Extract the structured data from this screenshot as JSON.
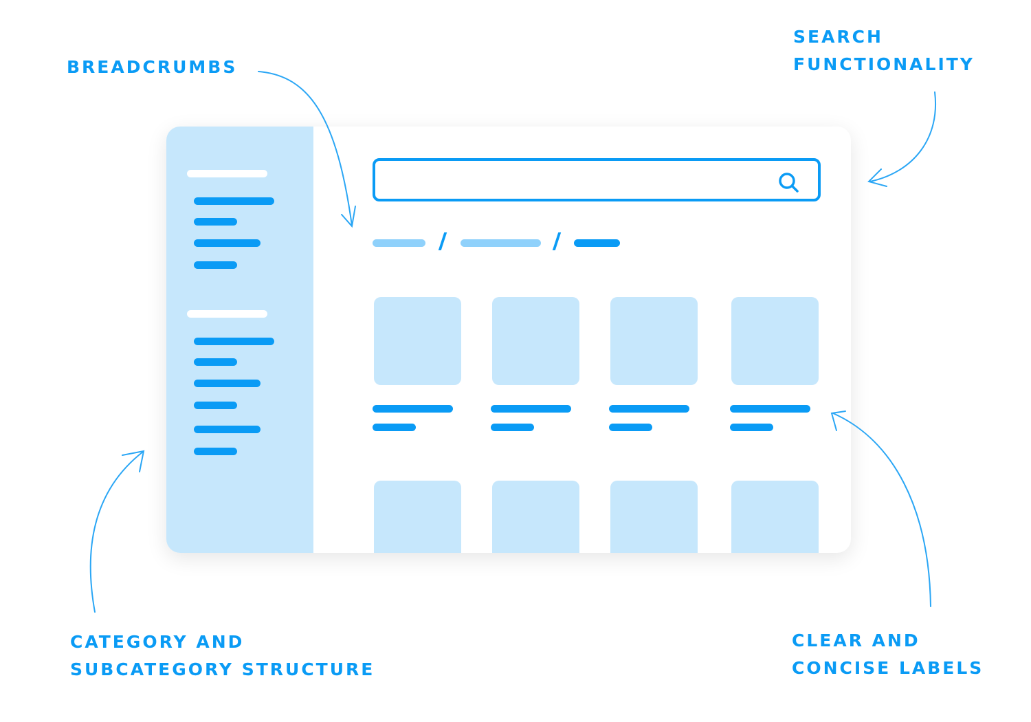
{
  "annotations": {
    "breadcrumbs": "BREADCRUMBS",
    "search_line1": "SEARCH",
    "search_line2": "FUNCTIONALITY",
    "category_line1": "CATEGORY AND",
    "category_line2": "SUBCATEGORY STRUCTURE",
    "labels_line1": "CLEAR AND",
    "labels_line2": "CONCISE LABELS"
  },
  "colors": {
    "accent": "#0a9bf5",
    "light_fill": "#c6e7fc",
    "breadcrumb_inactive": "#8fd1fb"
  },
  "search": {
    "value": "",
    "placeholder": "",
    "icon": "search-icon"
  },
  "breadcrumb": {
    "separator": "/",
    "levels": 3
  },
  "sidebar": {
    "groups": 2,
    "group1_items": 4,
    "group2_items": 6
  },
  "grid": {
    "columns": 4,
    "rows_visible": 2
  }
}
